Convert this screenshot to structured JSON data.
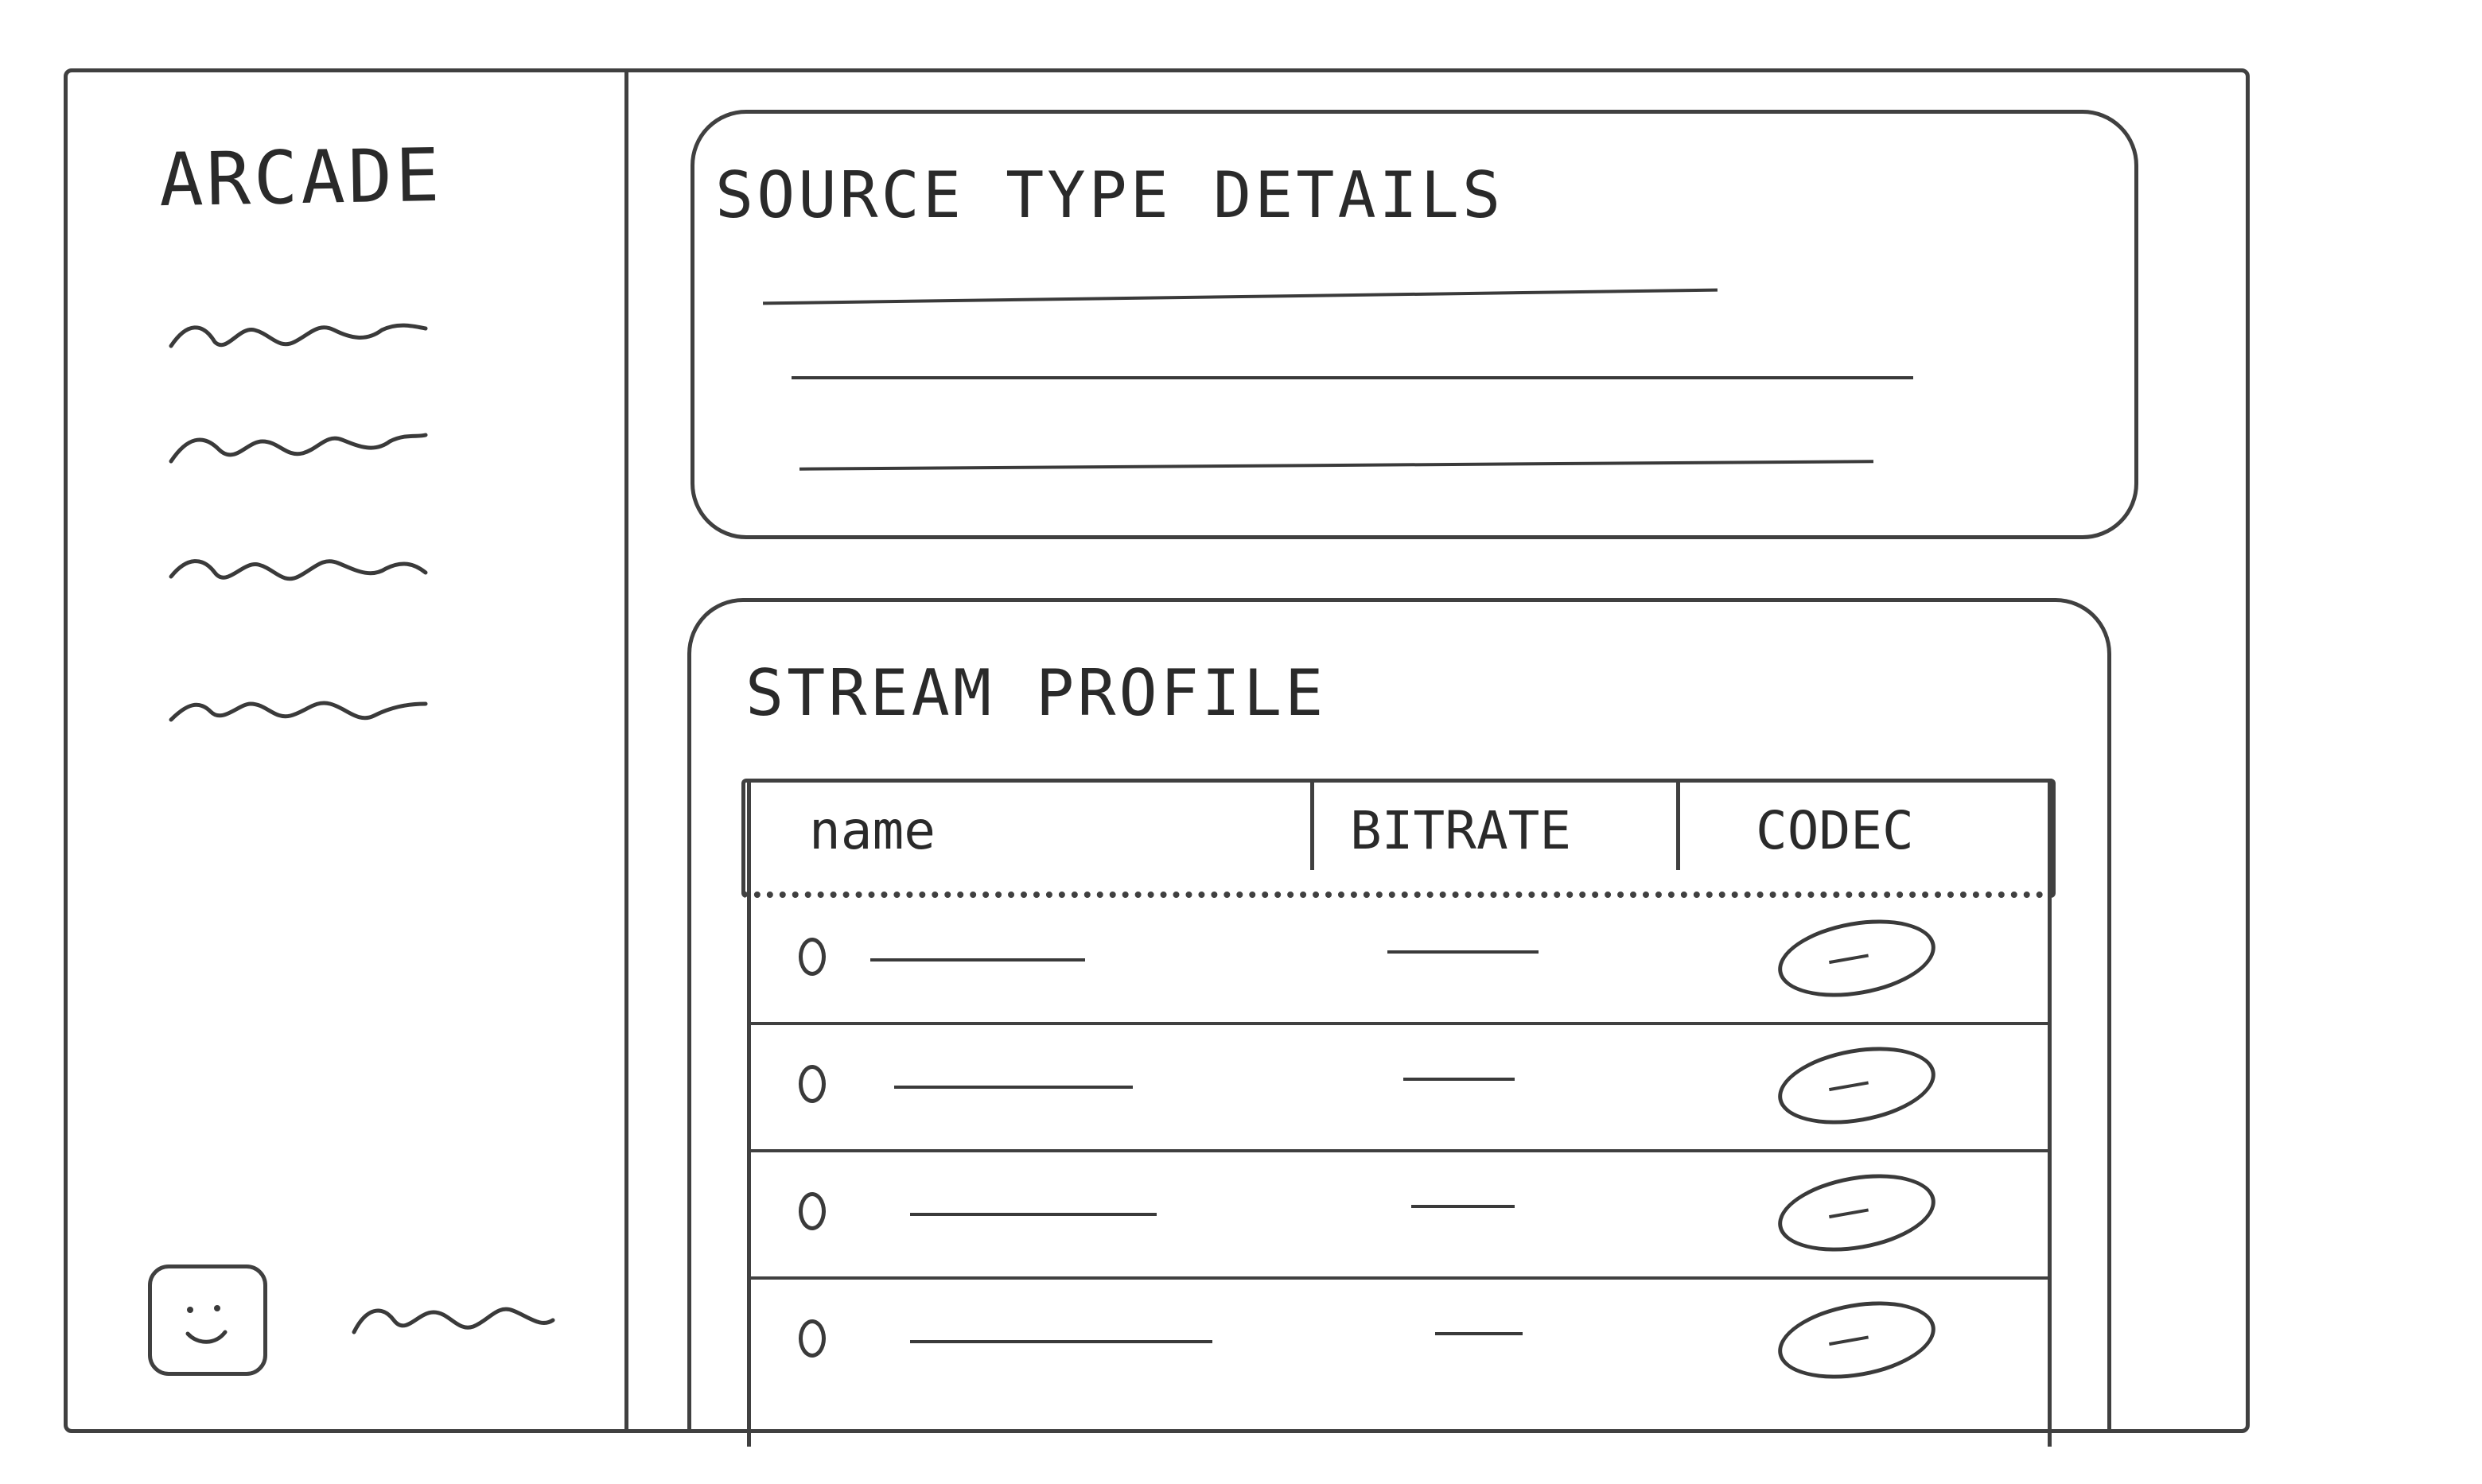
{
  "sidebar": {
    "app_title": "ARCADE",
    "nav_items": [
      {
        "icon": "squiggle-placeholder"
      },
      {
        "icon": "squiggle-placeholder"
      },
      {
        "icon": "squiggle-placeholder"
      },
      {
        "icon": "squiggle-placeholder"
      }
    ],
    "user": {
      "avatar_icon": "smiley-face-icon"
    }
  },
  "source_details": {
    "title": "SOURCE TYPE DETAILS",
    "lines": 3
  },
  "stream_profile": {
    "title": "STREAM PROFILE",
    "columns": [
      "name",
      "BITRATE",
      "CODEC"
    ],
    "rows": 4
  }
}
